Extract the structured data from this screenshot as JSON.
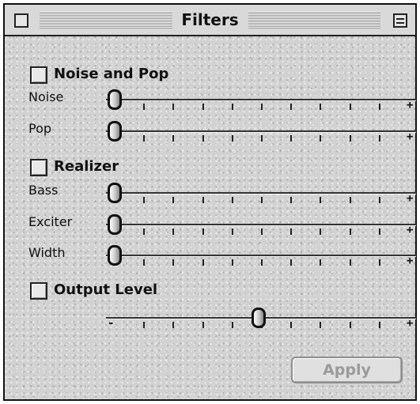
{
  "window": {
    "title": "Filters"
  },
  "sections": {
    "noise_and_pop": {
      "label": "Noise and Pop",
      "checked": false,
      "sliders": [
        {
          "label": "Noise",
          "value": 0
        },
        {
          "label": "Pop",
          "value": 0
        }
      ]
    },
    "realizer": {
      "label": "Realizer",
      "checked": false,
      "sliders": [
        {
          "label": "Bass",
          "value": 0
        },
        {
          "label": "Exciter",
          "value": 0
        },
        {
          "label": "Width",
          "value": 0
        }
      ]
    },
    "output_level": {
      "label": "Output Level",
      "checked": false,
      "slider": {
        "value": 0.5,
        "min_mark": "-",
        "max_mark": "+"
      }
    }
  },
  "slider_end_mark": "+",
  "apply": {
    "label": "Apply",
    "enabled": false
  }
}
